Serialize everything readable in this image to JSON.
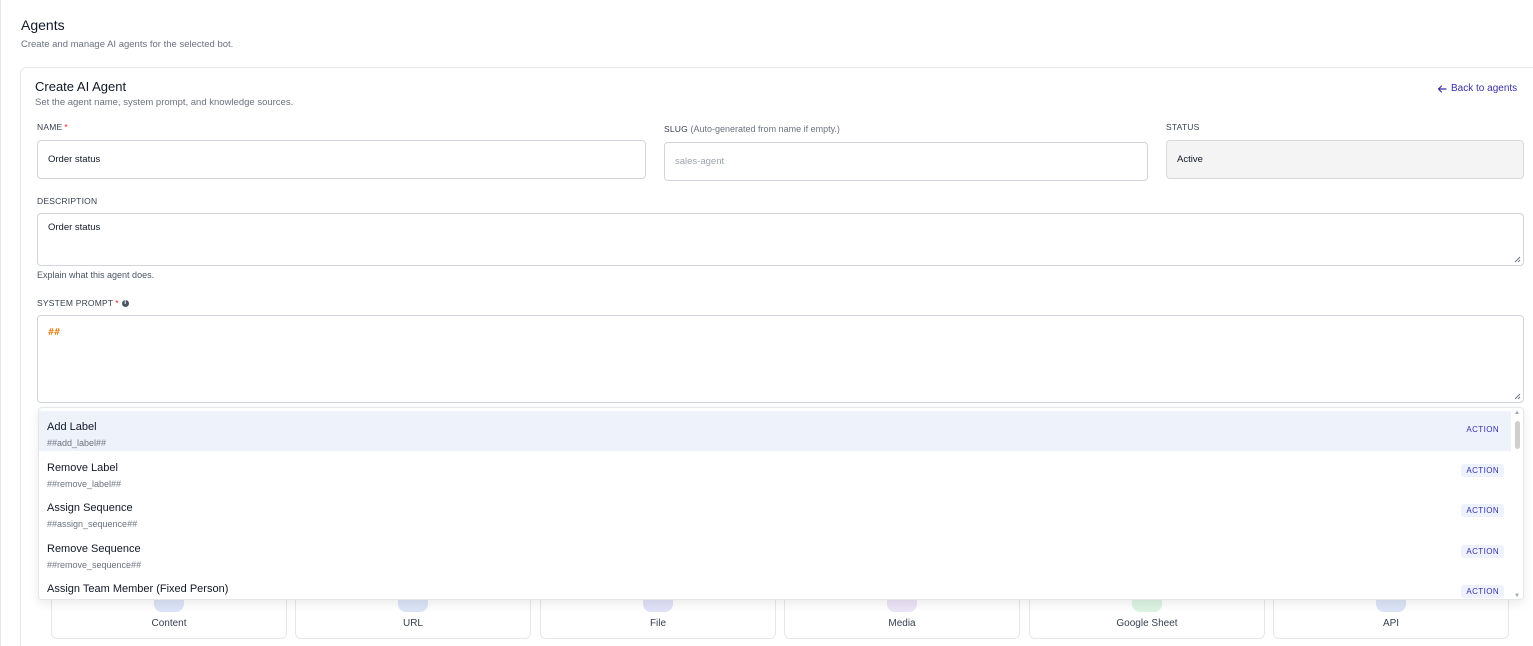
{
  "page": {
    "title": "Agents",
    "subtitle": "Create and manage AI agents for the selected bot."
  },
  "card": {
    "title": "Create AI Agent",
    "subtitle": "Set the agent name, system prompt, and knowledge sources.",
    "back_label": "Back to agents"
  },
  "form": {
    "name_label": "NAME",
    "required_mark": "*",
    "name_value": "Order status",
    "slug_label": "SLUG",
    "slug_hint": "(Auto-generated from name if empty.)",
    "slug_placeholder": "sales-agent",
    "status_label": "STATUS",
    "status_value": "Active",
    "description_label": "DESCRIPTION",
    "description_value": "Order status",
    "description_helper": "Explain what this agent does.",
    "system_prompt_label": "SYSTEM PROMPT",
    "system_prompt_value": "##"
  },
  "dropdown": {
    "items": [
      {
        "title": "Add Label",
        "code": "##add_label##",
        "badge": "ACTION"
      },
      {
        "title": "Remove Label",
        "code": "##remove_label##",
        "badge": "ACTION"
      },
      {
        "title": "Assign Sequence",
        "code": "##assign_sequence##",
        "badge": "ACTION"
      },
      {
        "title": "Remove Sequence",
        "code": "##remove_sequence##",
        "badge": "ACTION"
      },
      {
        "title": "Assign Team Member (Fixed Person)",
        "code": "",
        "badge": "ACTION"
      }
    ]
  },
  "sources": {
    "tiles": [
      {
        "label": "Content",
        "icon": "content-icon",
        "color": "#dbe4f7"
      },
      {
        "label": "URL",
        "icon": "link-icon",
        "color": "#dbe4f7"
      },
      {
        "label": "File",
        "icon": "file-icon",
        "color": "#e0e1f7"
      },
      {
        "label": "Media",
        "icon": "media-icon",
        "color": "#ece4f7"
      },
      {
        "label": "Google Sheet",
        "icon": "sheet-icon",
        "color": "#dcf3e2"
      },
      {
        "label": "API",
        "icon": "api-icon",
        "color": "#dbe4f7"
      }
    ]
  },
  "colors": {
    "accent": "#3730a3",
    "required": "#dc2626",
    "prompt_token": "#d97706",
    "highlight": "#eef2fb"
  }
}
